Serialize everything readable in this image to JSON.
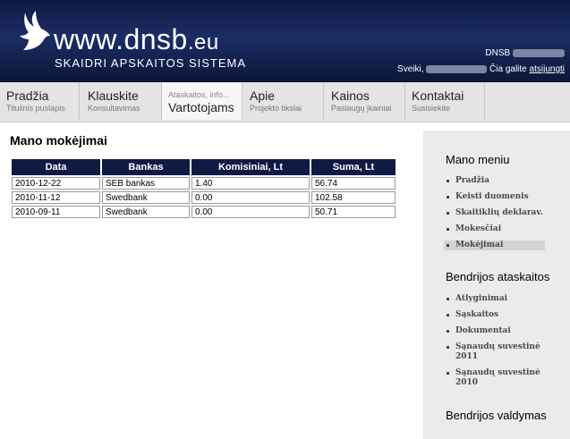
{
  "header": {
    "logo_main": "www.dnsb",
    "logo_tld": ".eu",
    "logo_sub": "SKAIDRI APSKAITOS SISTEMA",
    "org_label": "DNSB",
    "greeting": "Sveiki,",
    "logout_prefix": "Čia galite",
    "logout_link": "atsijungti"
  },
  "nav": [
    {
      "title": "Pradžia",
      "subtitle": "Titulinis puslapis"
    },
    {
      "title": "Klauskite",
      "subtitle": "Konsultavimas"
    },
    {
      "title": "Vartotojams",
      "subtitle": "Ataskaitos, info..."
    },
    {
      "title": "Apie",
      "subtitle": "Projekto tikslai"
    },
    {
      "title": "Kainos",
      "subtitle": "Paslaugų įkainiai"
    },
    {
      "title": "Kontaktai",
      "subtitle": "Susisiekite"
    }
  ],
  "main": {
    "title": "Mano mokėjimai",
    "columns": [
      "Data",
      "Bankas",
      "Komisiniai, Lt",
      "Suma, Lt"
    ],
    "rows": [
      [
        "2010-12-22",
        "SEB bankas",
        "1.40",
        "56.74"
      ],
      [
        "2010-11-12",
        "Swedbank",
        "0.00",
        "102.58"
      ],
      [
        "2010-09-11",
        "Swedbank",
        "0.00",
        "50.71"
      ]
    ]
  },
  "sidebar": {
    "menu_title": "Mano meniu",
    "menu_items": [
      "Pradžia",
      "Keisti duomenis",
      "Skaitiklių deklarav.",
      "Mokesčiai",
      "Mokėjimai"
    ],
    "reports_title": "Bendrijos ataskaitos",
    "report_items": [
      "Atlyginimai",
      "Sąskaitos",
      "Dokumentai",
      "Sąnaudų suvestinė 2011",
      "Sąnaudų suvestinė 2010"
    ],
    "board_title": "Bendrijos valdymas"
  },
  "colors": {
    "header_dark": "#0e1a44",
    "table_header": "#111a45",
    "sidebar_bg": "#ebebeb"
  }
}
